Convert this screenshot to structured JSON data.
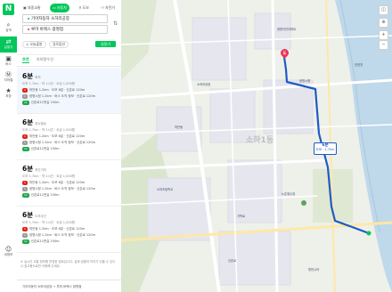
{
  "logo": "N",
  "rail": [
    {
      "icon": "search-icon",
      "glyph": "⌕",
      "label": "검색"
    },
    {
      "icon": "directions-icon",
      "glyph": "⇄",
      "label": "길찾기"
    },
    {
      "icon": "bus-icon",
      "glyph": "▣",
      "label": "버스"
    },
    {
      "icon": "subway-icon",
      "glyph": "Ⓜ",
      "label": "지하철"
    },
    {
      "icon": "bookmark-icon",
      "glyph": "★",
      "label": "저장"
    },
    {
      "icon": "user-icon",
      "glyph": "☺",
      "label": "내정보"
    }
  ],
  "modes": [
    {
      "icon": "bus-icon",
      "label": "대중교통"
    },
    {
      "icon": "car-icon",
      "label": "자동차"
    },
    {
      "icon": "walk-icon",
      "label": "도보"
    },
    {
      "icon": "bike-icon",
      "label": "자전거"
    }
  ],
  "route_inputs": {
    "origin": "기아자동차 소하리공장",
    "destination": "루마 바렉스 광명점",
    "opt_time": "오늘출발",
    "opt_filter": "경로옵션",
    "search_label": "길찾기"
  },
  "tabs": [
    "추천",
    "지하철우선"
  ],
  "routes": [
    {
      "time": "6분",
      "tag": "최적",
      "meta": "도보 1.7km · 약 1시간 · 요금 1,000원",
      "lines": [
        {
          "badge": "1",
          "badge_color": "red",
          "text": "하안동 1.2km  ·  도보 6분  ·  신촌로 120m"
        },
        {
          "badge": "1",
          "badge_color": "grey",
          "text": "광명시청 1.2km  ·  버스 도착 정보  ·  신촌로 120m"
        },
        {
          "badge": "11",
          "badge_color": "green",
          "text": "신촌로11번길 150m"
        }
      ]
    },
    {
      "time": "6분",
      "tag": "최소환승",
      "meta": "도보 1.7km · 약 1시간 · 요금 1,000원",
      "lines": [
        {
          "badge": "1",
          "badge_color": "red",
          "text": "하안동 1.2km  ·  도보 6분  ·  신촌로 120m"
        },
        {
          "badge": "1",
          "badge_color": "grey",
          "text": "광명시청 1.2km  ·  버스 도착 정보  ·  신촌로 120m"
        },
        {
          "badge": "11",
          "badge_color": "green",
          "text": "신촌로11번길 150m"
        }
      ]
    },
    {
      "time": "6분",
      "tag": "최단거리",
      "meta": "도보 1.7km · 약 1시간 · 요금 1,000원",
      "lines": [
        {
          "badge": "1",
          "badge_color": "red",
          "text": "하안동 1.2km  ·  도보 6분  ·  신촌로 120m"
        },
        {
          "badge": "1",
          "badge_color": "grey",
          "text": "광명시청 1.2km  ·  버스 도착 정보  ·  신촌로 120m"
        },
        {
          "badge": "11",
          "badge_color": "green",
          "text": "신촌로11번길 150m"
        }
      ]
    },
    {
      "time": "6분",
      "tag": "도보우선",
      "meta": "도보 1.7km · 약 1시간 · 요금 1,000원",
      "lines": [
        {
          "badge": "1",
          "badge_color": "red",
          "text": "하안동 1.2km  ·  도보 6분  ·  신촌로 120m"
        },
        {
          "badge": "1",
          "badge_color": "grey",
          "text": "광명시청 1.2km  ·  버스 도착 정보  ·  신촌로 120m"
        },
        {
          "badge": "11",
          "badge_color": "green",
          "text": "신촌로11번길 150m"
        }
      ]
    }
  ],
  "notice": "※ 실시간 교통 정보를 반영한 경로입니다. 실제 상황과 차이가 있을 수 있으니 참고용으로만 이용해 주세요.",
  "bottom_bar": "기아자동차 소하리공장  →  루마 바렉스 광명점",
  "map": {
    "district_label": "소하1동",
    "bubble_time": "6분",
    "bubble_dist": "도보 · 1.7km",
    "dest_label": "도",
    "labels": [
      "광명이안아파트",
      "광명시청",
      "소하리공장",
      "안양천",
      "하안동",
      "소하초등학교",
      "노온정수장",
      "가학로",
      "신촌로",
      "휴먼시아"
    ],
    "route_color": "#1e5bc6",
    "accent": "#03c75a"
  }
}
